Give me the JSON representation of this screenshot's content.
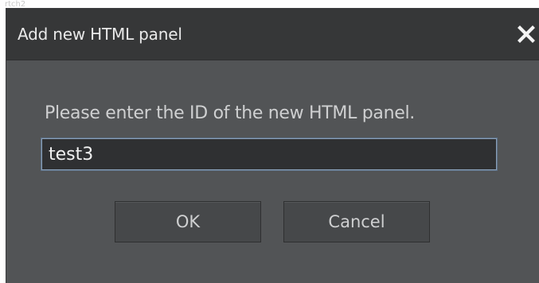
{
  "backdrop": {
    "ghost_text": "rtch2"
  },
  "dialog": {
    "title": "Add new HTML panel",
    "close_icon": "close-icon",
    "prompt": "Please enter the ID of the new HTML panel.",
    "input_value": "test3",
    "ok_label": "OK",
    "cancel_label": "Cancel"
  },
  "colors": {
    "titlebar": "#363738",
    "dialog_body": "#525456",
    "input_background": "#2f3032",
    "input_focus_border": "#8aa0b8",
    "button_background": "#46484a",
    "text_primary": "#e9e9e9"
  }
}
